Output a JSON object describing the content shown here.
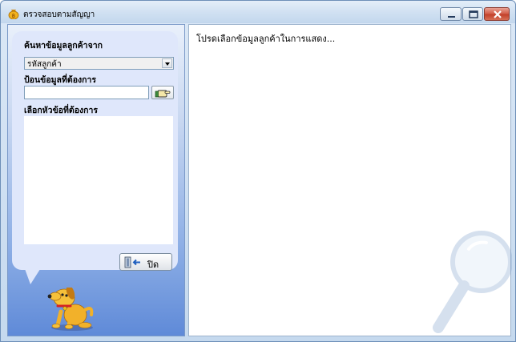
{
  "window": {
    "title": "ตรวจสอบตามสัญญา"
  },
  "search": {
    "heading": "ค้นหาข้อมูลลูกค้าจาก",
    "selected_field": "รหัสลูกค้า",
    "input_label": "ป้อนข้อมูลที่ต้องการ",
    "input_value": "",
    "topics_label": "เลือกหัวข้อที่ต้องการ",
    "topics": []
  },
  "buttons": {
    "close_label": "ปิด"
  },
  "main": {
    "message": "โปรดเลือกข้อมูลลูกค้าในการแสดง..."
  },
  "icons": {
    "app": "money-bag-icon",
    "go": "pointing-hand-icon",
    "close": "exit-door-icon",
    "mascot": "dog-mascot",
    "watermark": "magnifier-icon"
  }
}
